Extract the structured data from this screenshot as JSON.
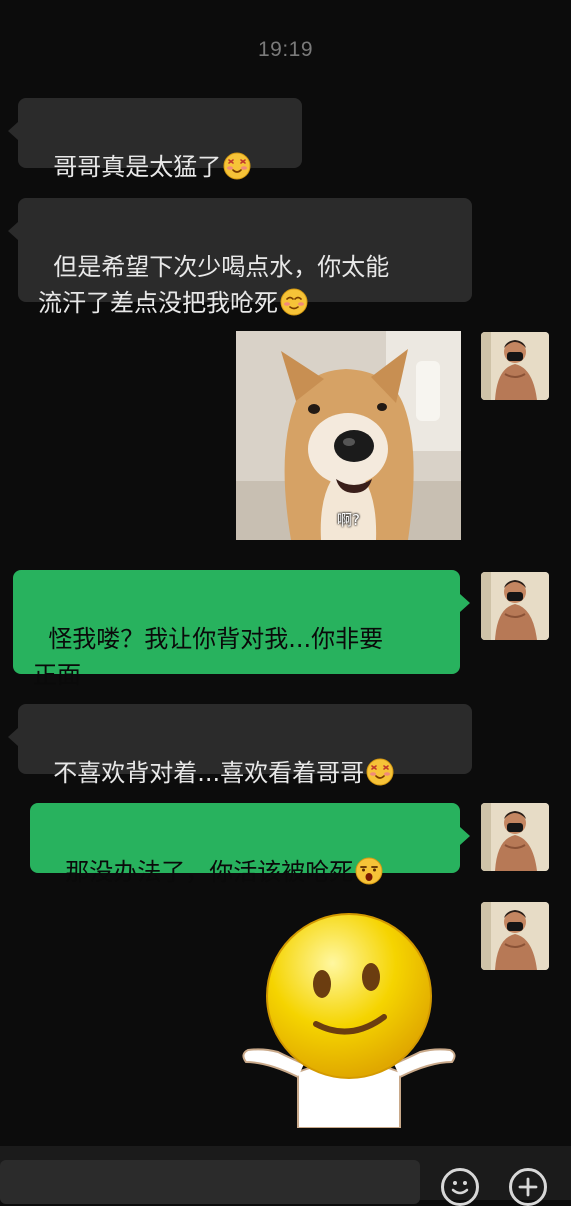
{
  "timestamp": "19:19",
  "colors": {
    "background": "#0c0c0c",
    "received_bubble": "#2b2b2b",
    "sent_bubble": "#28b25e",
    "received_text": "#e8e8e8",
    "sent_text": "#0a0a0a"
  },
  "messages": [
    {
      "side": "left",
      "text": "哥哥真是太猛了",
      "emoji": "blushing-smile-emoji"
    },
    {
      "side": "left",
      "text": "但是希望下次少喝点水，你太能\n流汗了差点没把我呛死",
      "emoji": "shy-smile-emoji"
    },
    {
      "side": "right",
      "type": "sticker",
      "sticker": "shiba-dog-sticker",
      "caption": "啊?"
    },
    {
      "side": "right",
      "text": "怪我喽？我让你背对我...你非要\n正面"
    },
    {
      "side": "left",
      "text": "不喜欢背对着...喜欢看着哥哥",
      "emoji": "blushing-smile-emoji"
    },
    {
      "side": "right",
      "text": "那没办法了，你活该被呛死",
      "emoji": "shocked-face-emoji"
    },
    {
      "side": "right",
      "type": "sticker",
      "sticker": "smiley-shrug-sticker"
    }
  ],
  "input_bar": {
    "icons": [
      "emoji-icon",
      "plus-icon"
    ]
  }
}
